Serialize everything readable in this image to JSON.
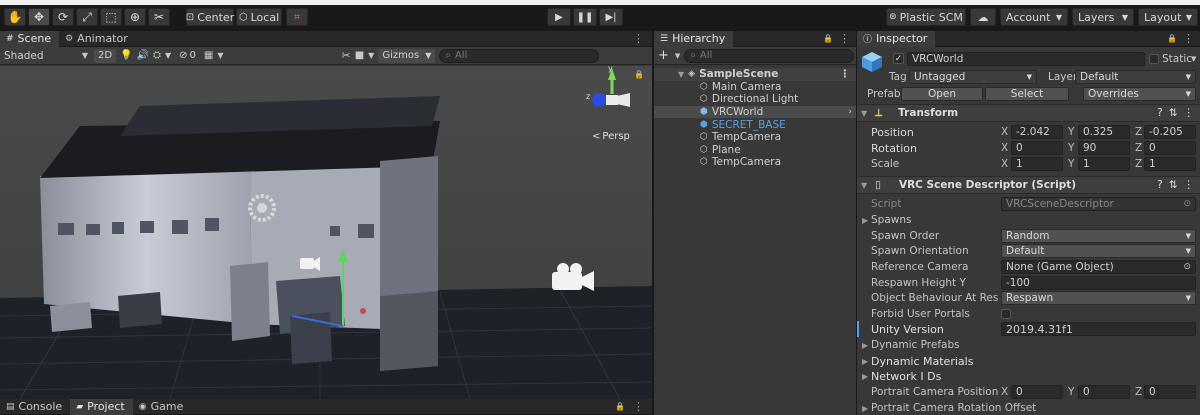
{
  "toolbar": {
    "center_label": "Center",
    "local_label": "Local",
    "plastic_label": "Plastic SCM",
    "account_label": "Account",
    "layers_label": "Layers",
    "layout_label": "Layout"
  },
  "scene": {
    "tabs": [
      {
        "label": "Scene"
      },
      {
        "label": "Animator"
      }
    ],
    "shading": "Shaded",
    "mode_2d": "2D",
    "hidden_count": "0",
    "gizmos_label": "Gizmos",
    "search_placeholder": "All",
    "persp_label": "Persp",
    "gizmo_axes": {
      "y": "y",
      "z": "z"
    }
  },
  "bottom_tabs": [
    {
      "label": "Console"
    },
    {
      "label": "Project"
    },
    {
      "label": "Game"
    }
  ],
  "hierarchy": {
    "title": "Hierarchy",
    "search_placeholder": "All",
    "scene_name": "SampleScene",
    "items": [
      {
        "label": "Main Camera"
      },
      {
        "label": "Directional Light"
      },
      {
        "label": "VRCWorld"
      },
      {
        "label": "SECRET_BASE"
      },
      {
        "label": "TempCamera"
      },
      {
        "label": "Plane"
      },
      {
        "label": "TempCamera"
      }
    ]
  },
  "inspector": {
    "title": "Inspector",
    "object_name": "VRCWorld",
    "static_label": "Static",
    "tag_label": "Tag",
    "tag_value": "Untagged",
    "layer_label": "Layer",
    "layer_value": "Default",
    "prefab_label": "Prefab",
    "open_label": "Open",
    "select_label": "Select",
    "overrides_label": "Overrides",
    "transform": {
      "title": "Transform",
      "position_label": "Position",
      "rotation_label": "Rotation",
      "scale_label": "Scale",
      "axis_x": "X",
      "axis_y": "Y",
      "axis_z": "Z",
      "position": {
        "x": "-2.042",
        "y": "0.325",
        "z": "-0.205"
      },
      "rotation": {
        "x": "0",
        "y": "90",
        "z": "0"
      },
      "scale": {
        "x": "1",
        "y": "1",
        "z": "1"
      }
    },
    "descriptor": {
      "title": "VRC Scene Descriptor (Script)",
      "script_label": "Script",
      "script_value": "VRCSceneDescriptor",
      "spawns_label": "Spawns",
      "spawn_order_label": "Spawn Order",
      "spawn_order_value": "Random",
      "spawn_orientation_label": "Spawn Orientation",
      "spawn_orientation_value": "Default",
      "reference_camera_label": "Reference Camera",
      "reference_camera_value": "None (Game Object)",
      "respawn_height_label": "Respawn Height Y",
      "respawn_height_value": "-100",
      "object_behaviour_label": "Object Behaviour At Respawn",
      "object_behaviour_value": "Respawn",
      "forbid_portals_label": "Forbid User Portals",
      "unity_version_label": "Unity Version",
      "unity_version_value": "2019.4.31f1",
      "dynamic_prefabs_label": "Dynamic Prefabs",
      "dynamic_materials_label": "Dynamic Materials",
      "network_ids_label": "Network I Ds",
      "portrait_pos_label": "Portrait Camera Position Offset",
      "portrait_pos": {
        "x": "0",
        "y": "0",
        "z": "0"
      },
      "portrait_rot_label": "Portrait Camera Rotation Offset"
    }
  },
  "colors": {
    "accent_blue": "#5aa0e6",
    "selected_row": "#4b4b4b",
    "panel": "#383838"
  }
}
